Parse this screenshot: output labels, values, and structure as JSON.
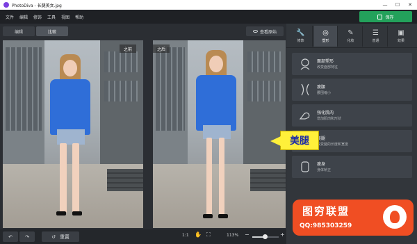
{
  "window": {
    "title": "PhotoDiva - 长腿美女.jpg"
  },
  "menu": [
    "文件",
    "编辑",
    "修饰",
    "工具",
    "视图",
    "帮助"
  ],
  "save_label": "保存",
  "tabs": {
    "edit": "编辑",
    "compare": "比较"
  },
  "view_original_label": "查看原始",
  "panes": {
    "before_label": "之前",
    "after_label": "之后"
  },
  "bottom": {
    "reset_label": "重置",
    "ratio": "1:1",
    "zoom": "113%"
  },
  "sidebar": {
    "tabs": [
      {
        "label": "修饰",
        "icon": "wrench-icon",
        "glyph": "🔧"
      },
      {
        "label": "塑形",
        "icon": "shape-icon",
        "glyph": "◎"
      },
      {
        "label": "化妆",
        "icon": "makeup-icon",
        "glyph": "✎"
      },
      {
        "label": "普通",
        "icon": "sliders-icon",
        "glyph": "☰"
      },
      {
        "label": "效果",
        "icon": "effects-icon",
        "glyph": "▣"
      }
    ],
    "tools": [
      {
        "name": "面部塑形",
        "desc": "改变面部特征",
        "icon": "face-shape-icon"
      },
      {
        "name": "瘦腰",
        "desc": "腰围缩小",
        "icon": "waist-icon"
      },
      {
        "name": "强化肌肉",
        "desc": "增加肌肉和形状",
        "icon": "muscle-icon"
      },
      {
        "name": "美腿",
        "desc": "改变腿的长度和宽度",
        "icon": "legs-icon"
      },
      {
        "name": "瘦身",
        "desc": "身体矫正",
        "icon": "body-icon"
      }
    ]
  },
  "callout_text": "美腿",
  "watermark": {
    "title": "图穷联盟",
    "qq": "QQ:985303259"
  }
}
